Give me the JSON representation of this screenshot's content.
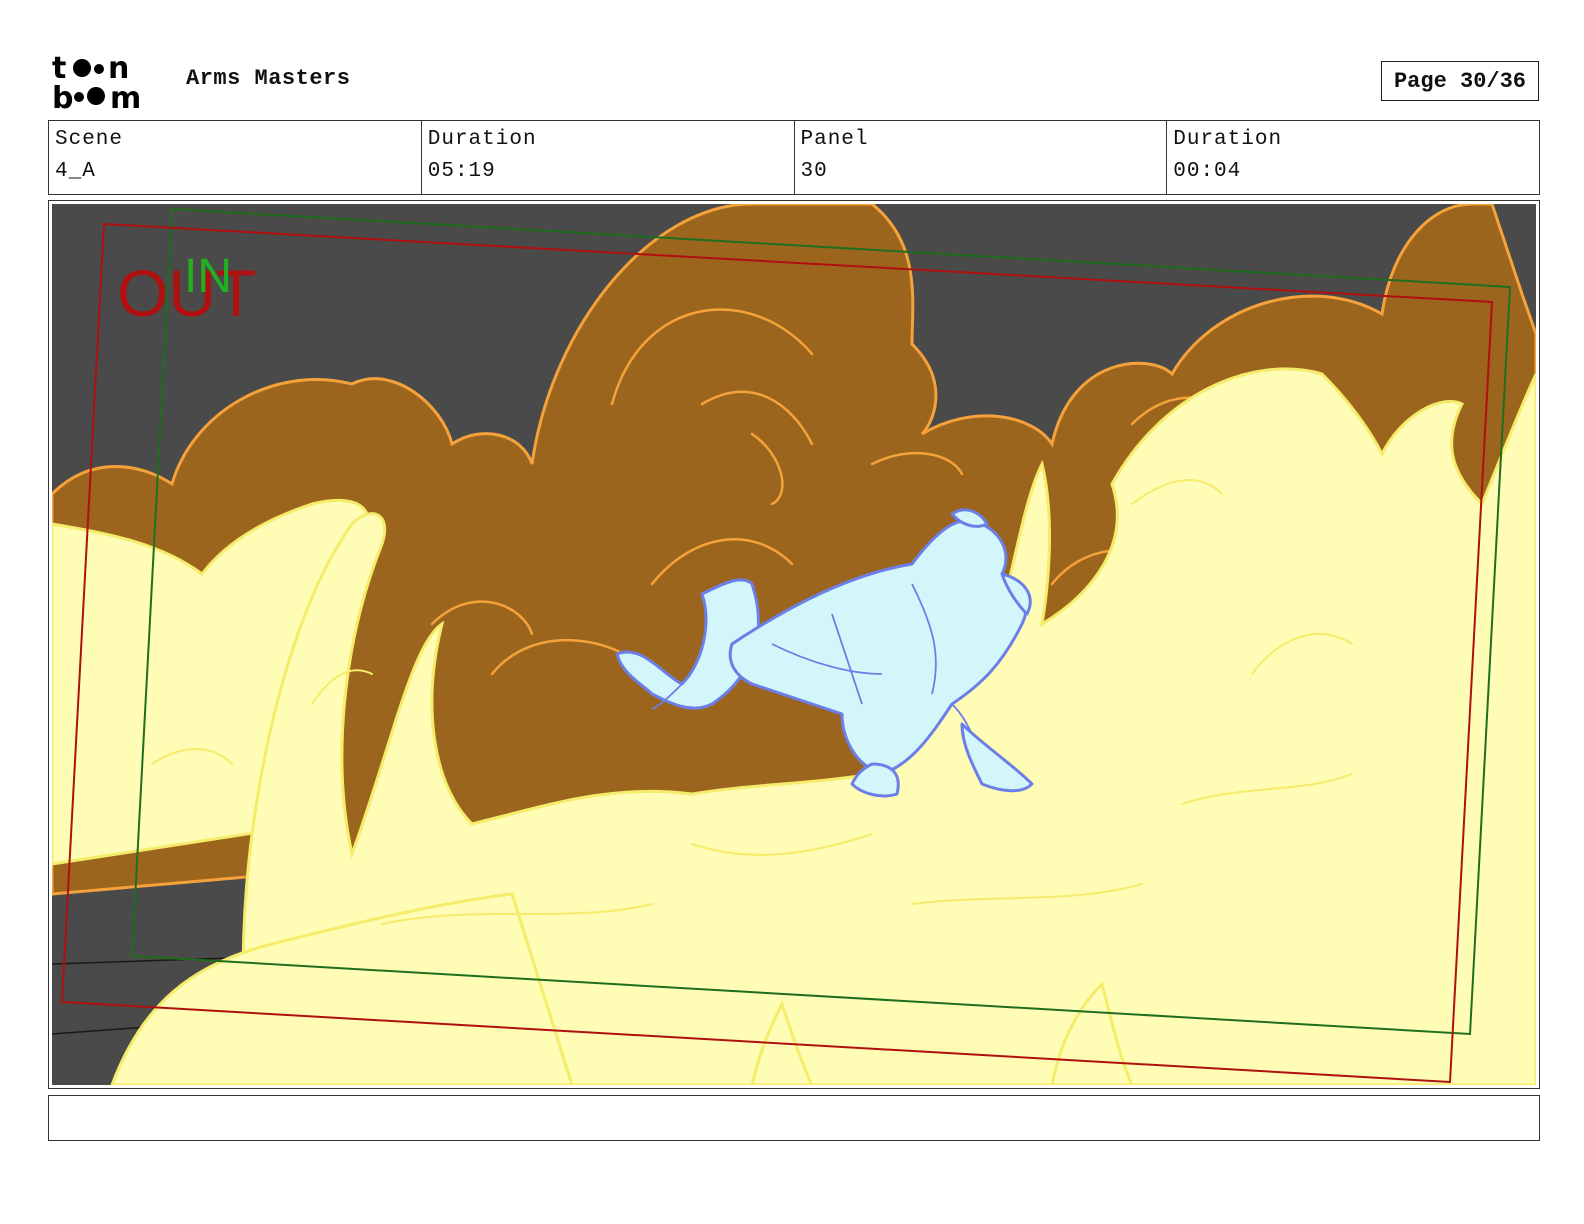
{
  "header": {
    "logo_text": "toon boom",
    "project_title": "Arms Masters",
    "page_label": "Page 30/36"
  },
  "info": [
    {
      "label": "Scene",
      "value": "4_A"
    },
    {
      "label": "Duration",
      "value": "05:19"
    },
    {
      "label": "Panel",
      "value": "30"
    },
    {
      "label": "Duration",
      "value": "00:04"
    }
  ],
  "panel": {
    "in_label": "IN",
    "out_label": "OUT",
    "colors": {
      "background": "#4a4a4a",
      "smoke": "#9c651e",
      "smoke_outline": "#f5a23a",
      "fire": "#fffcb5",
      "fire_outline": "#f4ec6a",
      "character": "#d3f6fb",
      "character_outline": "#6c7fe8",
      "in_frame": "#1e6e1e",
      "out_frame": "#b01010"
    }
  },
  "caption": ""
}
